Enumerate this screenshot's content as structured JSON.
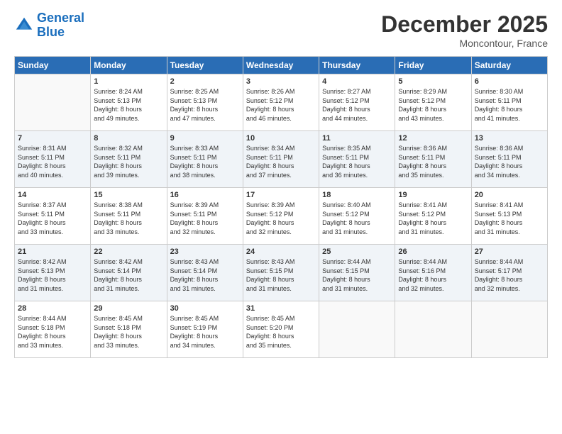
{
  "logo": {
    "line1": "General",
    "line2": "Blue"
  },
  "header": {
    "month": "December 2025",
    "location": "Moncontour, France"
  },
  "days_of_week": [
    "Sunday",
    "Monday",
    "Tuesday",
    "Wednesday",
    "Thursday",
    "Friday",
    "Saturday"
  ],
  "weeks": [
    [
      {
        "num": "",
        "info": ""
      },
      {
        "num": "1",
        "info": "Sunrise: 8:24 AM\nSunset: 5:13 PM\nDaylight: 8 hours\nand 49 minutes."
      },
      {
        "num": "2",
        "info": "Sunrise: 8:25 AM\nSunset: 5:13 PM\nDaylight: 8 hours\nand 47 minutes."
      },
      {
        "num": "3",
        "info": "Sunrise: 8:26 AM\nSunset: 5:12 PM\nDaylight: 8 hours\nand 46 minutes."
      },
      {
        "num": "4",
        "info": "Sunrise: 8:27 AM\nSunset: 5:12 PM\nDaylight: 8 hours\nand 44 minutes."
      },
      {
        "num": "5",
        "info": "Sunrise: 8:29 AM\nSunset: 5:12 PM\nDaylight: 8 hours\nand 43 minutes."
      },
      {
        "num": "6",
        "info": "Sunrise: 8:30 AM\nSunset: 5:11 PM\nDaylight: 8 hours\nand 41 minutes."
      }
    ],
    [
      {
        "num": "7",
        "info": "Sunrise: 8:31 AM\nSunset: 5:11 PM\nDaylight: 8 hours\nand 40 minutes."
      },
      {
        "num": "8",
        "info": "Sunrise: 8:32 AM\nSunset: 5:11 PM\nDaylight: 8 hours\nand 39 minutes."
      },
      {
        "num": "9",
        "info": "Sunrise: 8:33 AM\nSunset: 5:11 PM\nDaylight: 8 hours\nand 38 minutes."
      },
      {
        "num": "10",
        "info": "Sunrise: 8:34 AM\nSunset: 5:11 PM\nDaylight: 8 hours\nand 37 minutes."
      },
      {
        "num": "11",
        "info": "Sunrise: 8:35 AM\nSunset: 5:11 PM\nDaylight: 8 hours\nand 36 minutes."
      },
      {
        "num": "12",
        "info": "Sunrise: 8:36 AM\nSunset: 5:11 PM\nDaylight: 8 hours\nand 35 minutes."
      },
      {
        "num": "13",
        "info": "Sunrise: 8:36 AM\nSunset: 5:11 PM\nDaylight: 8 hours\nand 34 minutes."
      }
    ],
    [
      {
        "num": "14",
        "info": "Sunrise: 8:37 AM\nSunset: 5:11 PM\nDaylight: 8 hours\nand 33 minutes."
      },
      {
        "num": "15",
        "info": "Sunrise: 8:38 AM\nSunset: 5:11 PM\nDaylight: 8 hours\nand 33 minutes."
      },
      {
        "num": "16",
        "info": "Sunrise: 8:39 AM\nSunset: 5:11 PM\nDaylight: 8 hours\nand 32 minutes."
      },
      {
        "num": "17",
        "info": "Sunrise: 8:39 AM\nSunset: 5:12 PM\nDaylight: 8 hours\nand 32 minutes."
      },
      {
        "num": "18",
        "info": "Sunrise: 8:40 AM\nSunset: 5:12 PM\nDaylight: 8 hours\nand 31 minutes."
      },
      {
        "num": "19",
        "info": "Sunrise: 8:41 AM\nSunset: 5:12 PM\nDaylight: 8 hours\nand 31 minutes."
      },
      {
        "num": "20",
        "info": "Sunrise: 8:41 AM\nSunset: 5:13 PM\nDaylight: 8 hours\nand 31 minutes."
      }
    ],
    [
      {
        "num": "21",
        "info": "Sunrise: 8:42 AM\nSunset: 5:13 PM\nDaylight: 8 hours\nand 31 minutes."
      },
      {
        "num": "22",
        "info": "Sunrise: 8:42 AM\nSunset: 5:14 PM\nDaylight: 8 hours\nand 31 minutes."
      },
      {
        "num": "23",
        "info": "Sunrise: 8:43 AM\nSunset: 5:14 PM\nDaylight: 8 hours\nand 31 minutes."
      },
      {
        "num": "24",
        "info": "Sunrise: 8:43 AM\nSunset: 5:15 PM\nDaylight: 8 hours\nand 31 minutes."
      },
      {
        "num": "25",
        "info": "Sunrise: 8:44 AM\nSunset: 5:15 PM\nDaylight: 8 hours\nand 31 minutes."
      },
      {
        "num": "26",
        "info": "Sunrise: 8:44 AM\nSunset: 5:16 PM\nDaylight: 8 hours\nand 32 minutes."
      },
      {
        "num": "27",
        "info": "Sunrise: 8:44 AM\nSunset: 5:17 PM\nDaylight: 8 hours\nand 32 minutes."
      }
    ],
    [
      {
        "num": "28",
        "info": "Sunrise: 8:44 AM\nSunset: 5:18 PM\nDaylight: 8 hours\nand 33 minutes."
      },
      {
        "num": "29",
        "info": "Sunrise: 8:45 AM\nSunset: 5:18 PM\nDaylight: 8 hours\nand 33 minutes."
      },
      {
        "num": "30",
        "info": "Sunrise: 8:45 AM\nSunset: 5:19 PM\nDaylight: 8 hours\nand 34 minutes."
      },
      {
        "num": "31",
        "info": "Sunrise: 8:45 AM\nSunset: 5:20 PM\nDaylight: 8 hours\nand 35 minutes."
      },
      {
        "num": "",
        "info": ""
      },
      {
        "num": "",
        "info": ""
      },
      {
        "num": "",
        "info": ""
      }
    ]
  ]
}
